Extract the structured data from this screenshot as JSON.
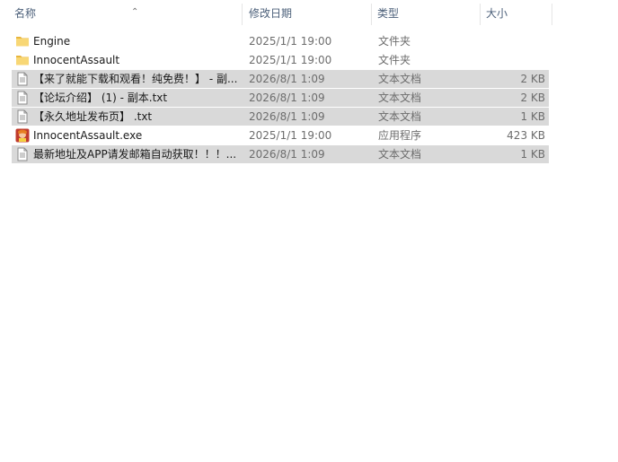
{
  "columns": {
    "name": "名称",
    "date": "修改日期",
    "type": "类型",
    "size": "大小"
  },
  "files": [
    {
      "name": "Engine",
      "date": "2025/1/1 19:00",
      "type": "文件夹",
      "size": "",
      "icon": "folder-icon",
      "selected": false
    },
    {
      "name": "InnocentAssault",
      "date": "2025/1/1 19:00",
      "type": "文件夹",
      "size": "",
      "icon": "folder-icon",
      "selected": false
    },
    {
      "name": "【来了就能下载和观看！纯免费！】 - 副...",
      "date": "2026/8/1 1:09",
      "type": "文本文档",
      "size": "2 KB",
      "icon": "text-file-icon",
      "selected": true
    },
    {
      "name": "【论坛介绍】 (1) - 副本.txt",
      "date": "2026/8/1 1:09",
      "type": "文本文档",
      "size": "2 KB",
      "icon": "text-file-icon",
      "selected": true
    },
    {
      "name": "【永久地址发布页】 .txt",
      "date": "2026/8/1 1:09",
      "type": "文本文档",
      "size": "1 KB",
      "icon": "text-file-icon",
      "selected": true
    },
    {
      "name": "InnocentAssault.exe",
      "date": "2025/1/1 19:00",
      "type": "应用程序",
      "size": "423 KB",
      "icon": "app-icon",
      "selected": false
    },
    {
      "name": "最新地址及APP请发邮箱自动获取！！！...",
      "date": "2026/8/1 1:09",
      "type": "文本文档",
      "size": "1 KB",
      "icon": "text-file-icon",
      "selected": true
    }
  ],
  "colors": {
    "selection": "#d9d9d9",
    "header_text": "#4c607a",
    "folder": "#f8d775"
  }
}
